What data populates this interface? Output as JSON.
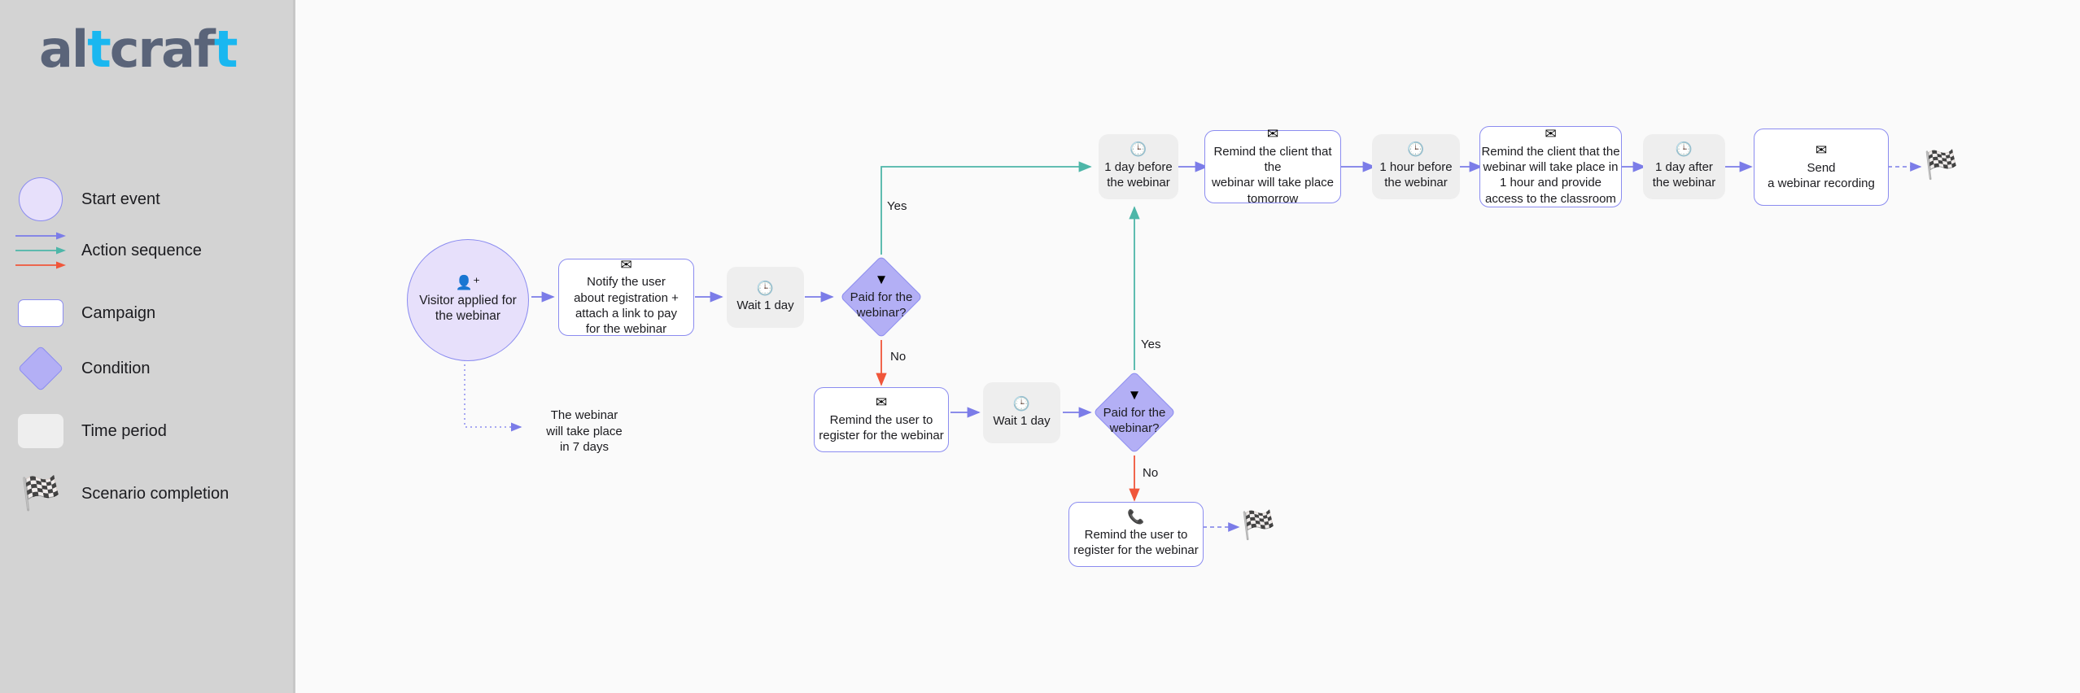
{
  "app": {
    "logo_text_1": "al",
    "logo_accent_1": "t",
    "logo_text_2": "craf",
    "logo_accent_2": "t",
    "background": "#fafafa",
    "sidebar_background": "#d3d3d3"
  },
  "colors": {
    "arrow_blue": "#7b7ce8",
    "arrow_green": "#4db6a8",
    "arrow_red": "#f0563a",
    "campaign_fill": "#ffffff",
    "campaign_border": "#8b8cf0",
    "condition_fill": "#b3aff5",
    "condition_border": "#8b8cf0",
    "start_fill": "#e7e0fb",
    "time_fill": "#eeeeee",
    "logo_color": "#5a6479",
    "logo_accent": "#19b7f0"
  },
  "legend": {
    "items": [
      {
        "shape": "circle",
        "label": "Start event"
      },
      {
        "shape": "arrows",
        "label": "Action sequence"
      },
      {
        "shape": "campaign",
        "label": "Campaign"
      },
      {
        "shape": "diamond",
        "label": "Condition"
      },
      {
        "shape": "time",
        "label": "Time period"
      },
      {
        "shape": "flag",
        "label": "Scenario completion",
        "glyph": "🏁"
      }
    ]
  },
  "flow": {
    "nodes": [
      {
        "id": "start",
        "type": "start-event",
        "icon": "add-person-icon",
        "glyph": "👤⁺",
        "text": "Visitor applied for\nthe webinar"
      },
      {
        "id": "campaign1",
        "type": "campaign",
        "icon": "envelope-icon",
        "glyph": "✉",
        "text": "Notify the user\nabout registration +\nattach a link to pay\nfor the webinar"
      },
      {
        "id": "wait1",
        "type": "time-period",
        "icon": "clock-icon",
        "glyph": "🕒",
        "text": "Wait 1 day"
      },
      {
        "id": "cond1",
        "type": "condition",
        "icon": "filter-icon",
        "glyph": "▼",
        "text": "Paid for the\nwebinar?"
      },
      {
        "id": "campaign2",
        "type": "campaign",
        "icon": "envelope-icon",
        "glyph": "✉",
        "text": "Remind the user to\nregister for the webinar"
      },
      {
        "id": "wait2",
        "type": "time-period",
        "icon": "clock-icon",
        "glyph": "🕒",
        "text": "Wait 1 day"
      },
      {
        "id": "cond2",
        "type": "condition",
        "icon": "filter-icon",
        "glyph": "▼",
        "text": "Paid for the\nwebinar?"
      },
      {
        "id": "campaign3",
        "type": "campaign",
        "icon": "phone-check-icon",
        "glyph": "📞",
        "text": "Remind the user to\nregister for the webinar"
      },
      {
        "id": "time_1day_before",
        "type": "time-period",
        "icon": "clock-icon",
        "glyph": "🕒",
        "text": "1 day before\nthe webinar"
      },
      {
        "id": "campaign4",
        "type": "campaign",
        "icon": "envelope-icon",
        "glyph": "✉",
        "text": "Remind the client that the\nwebinar will take place\ntomorrow"
      },
      {
        "id": "time_1hour_before",
        "type": "time-period",
        "icon": "clock-icon",
        "glyph": "🕒",
        "text": "1 hour before\nthe webinar"
      },
      {
        "id": "campaign5",
        "type": "campaign",
        "icon": "envelope-icon",
        "glyph": "✉",
        "text": "Remind the client that the\nwebinar will take place in\n1 hour and provide\naccess to the classroom"
      },
      {
        "id": "time_1day_after",
        "type": "time-period",
        "icon": "clock-icon",
        "glyph": "🕒",
        "text": "1 day after\nthe webinar"
      },
      {
        "id": "campaign6",
        "type": "campaign",
        "icon": "envelope-icon",
        "glyph": "✉",
        "text": "Send\na webinar recording"
      },
      {
        "id": "flag_top",
        "type": "completion",
        "icon": "checkered-flag-icon",
        "glyph": "🏁"
      },
      {
        "id": "flag_bottom",
        "type": "completion",
        "icon": "checkered-flag-icon",
        "glyph": "🏁"
      }
    ],
    "edge_labels": {
      "cond1_yes": "Yes",
      "cond1_no": "No",
      "cond2_yes": "Yes",
      "cond2_no": "No"
    },
    "note": "The webinar\nwill take place\nin 7 days"
  }
}
